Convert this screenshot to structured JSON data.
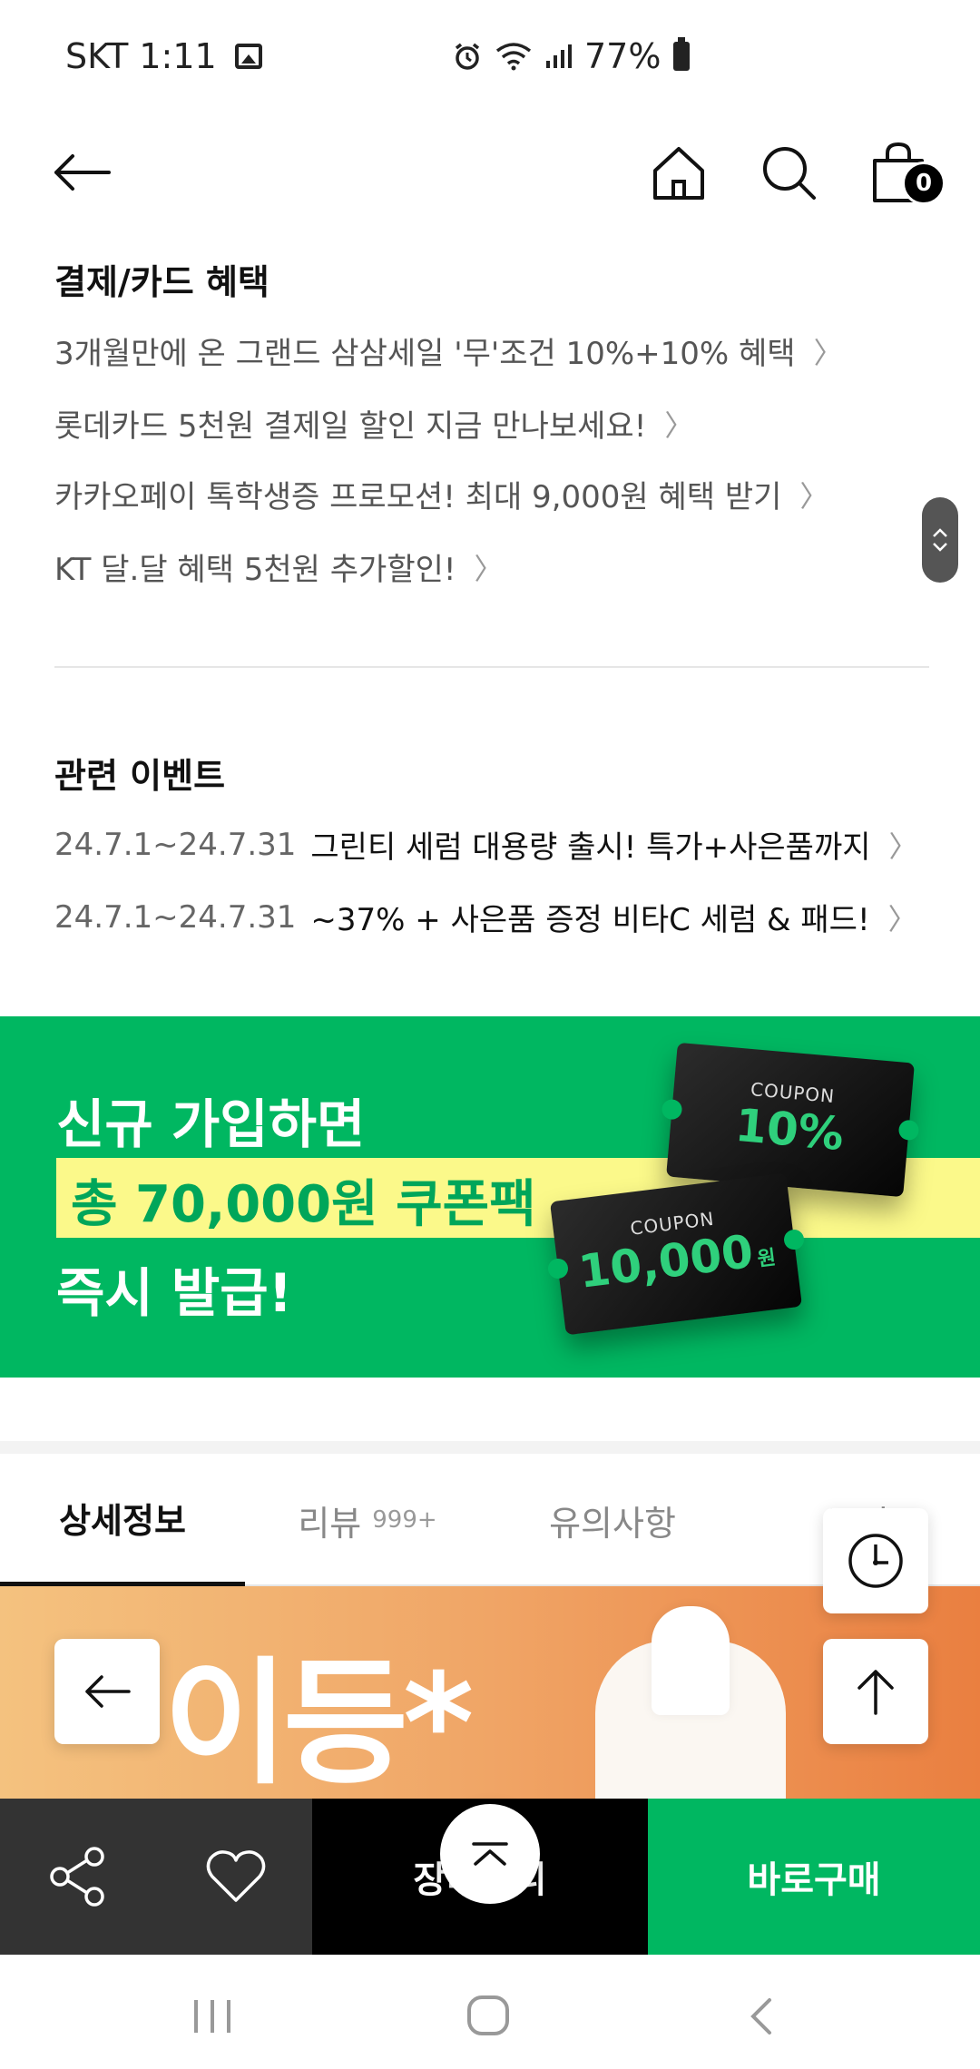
{
  "status_bar": {
    "carrier_time": "SKT 1:11",
    "battery": "77%"
  },
  "header": {
    "cart_count": "0"
  },
  "payment_benefits": {
    "title": "결제/카드 혜택",
    "items": [
      {
        "label": "3개월만에 온 그랜드 삼삼세일 '무'조건 10%+10% 혜택"
      },
      {
        "label": "롯데카드 5천원 결제일 할인 지금 만나보세요!"
      },
      {
        "label": "카카오페이 톡학생증 프로모션! 최대 9,000원 혜택 받기"
      },
      {
        "label": "KT 달.달 혜택 5천원 추가할인!"
      }
    ]
  },
  "related_events": {
    "title": "관련 이벤트",
    "items": [
      {
        "date": "24.7.1~24.7.31",
        "title": "그린티 세럼 대용량 출시! 특가+사은품까지"
      },
      {
        "date": "24.7.1~24.7.31",
        "title": "~37% + 사은품 증정 비타C 세럼 & 패드!"
      }
    ]
  },
  "banner": {
    "line1": "신규 가입하면",
    "line2": "총 70,000원 쿠폰팩",
    "line3": "즉시 발급!",
    "coupon1_label": "COUPON",
    "coupon1_value": "10%",
    "coupon2_label": "COUPON",
    "coupon2_value": "10,000",
    "coupon2_unit": "원"
  },
  "tabs": [
    {
      "label": "상세정보"
    },
    {
      "label": "리뷰",
      "count": "999+"
    },
    {
      "label": "유의사항"
    },
    {
      "label": "문의"
    }
  ],
  "product_image_text": "이등*",
  "action_bar": {
    "cart_label": "장바구니",
    "buy_label": "바로구매"
  },
  "colors": {
    "accent_green": "#00b761",
    "highlight_yellow": "#fbf98a"
  }
}
